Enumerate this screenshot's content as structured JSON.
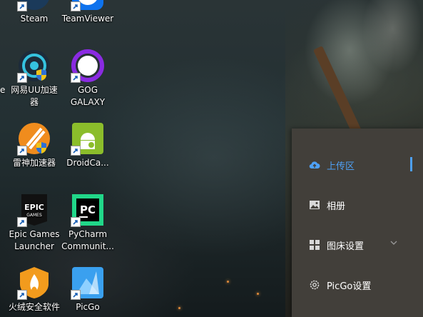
{
  "desktop": {
    "icons": [
      {
        "label_lines": [
          "Steam"
        ],
        "icon": "steam-icon"
      },
      {
        "label_lines": [
          "TeamViewer"
        ],
        "icon": "teamviewer-icon"
      },
      {
        "label_lines": [
          "网易UU加速",
          "器"
        ],
        "icon": "netease-uu-icon"
      },
      {
        "label_lines": [
          "GOG",
          "GALAXY"
        ],
        "icon": "gog-galaxy-icon"
      },
      {
        "label_lines": [
          "雷神加速器"
        ],
        "icon": "leishen-accelerator-icon"
      },
      {
        "label_lines": [
          "DroidCa..."
        ],
        "icon": "droidcam-icon"
      },
      {
        "label_lines": [
          "Epic Games",
          "Launcher"
        ],
        "icon": "epic-games-icon"
      },
      {
        "label_lines": [
          "PyCharm",
          "Communit..."
        ],
        "icon": "pycharm-icon"
      },
      {
        "label_lines": [
          "火绒安全软件"
        ],
        "icon": "huorong-icon"
      },
      {
        "label_lines": [
          "PicGo"
        ],
        "icon": "picgo-icon"
      }
    ],
    "partial_left_label": "e"
  },
  "picgo_menu": {
    "items": [
      {
        "label": "上传区",
        "icon": "cloud-upload-icon",
        "active": true
      },
      {
        "label": "相册",
        "icon": "image-icon",
        "active": false
      },
      {
        "label": "图床设置",
        "icon": "grid-icon",
        "active": false,
        "has_submenu": true
      },
      {
        "label": "PicGo设置",
        "icon": "gear-icon",
        "active": false
      }
    ],
    "colors": {
      "background": "#423f3a",
      "active": "#4ea0f5",
      "text": "#ffffff"
    }
  }
}
